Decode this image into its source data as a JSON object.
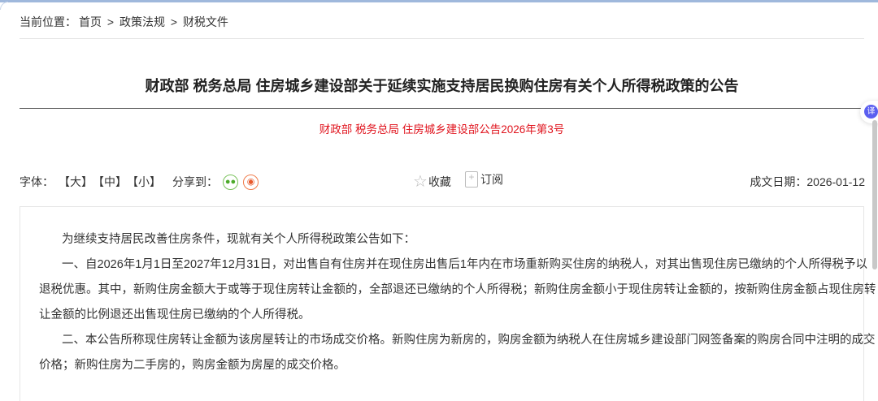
{
  "breadcrumb": {
    "label": "当前位置：",
    "items": [
      "首页",
      "政策法规",
      "财税文件"
    ],
    "sep": ">"
  },
  "title": "财政部 税务总局 住房城乡建设部关于延续实施支持居民换购住房有关个人所得税政策的公告",
  "doc_number": "财政部 税务总局 住房城乡建设部公告2026年第3号",
  "toolbar": {
    "font_label": "字体：",
    "font_large": "【大】",
    "font_medium": "【中】",
    "font_small": "【小】",
    "share_label": "分享到：",
    "favorite": "收藏",
    "subscribe": "订阅",
    "date_label": "成文日期：",
    "date": "2026-01-12"
  },
  "translate_label": "译",
  "body": {
    "paragraphs": [
      [
        "为继续支持居民改善住房条件，现就有关个人所得税政策公告如下："
      ],
      [
        "一、自2026年1月1日至2027年12月31日，对出售自有住房并在现住房出售后1年内在市场重新购买住房的纳税人，对其出售现住房已缴纳的个人所得税予以",
        "退税优惠。其中，新购住房金额大于或等于现住房转让金额的，全部退还已缴纳的个人所得税；新购住房金额小于现住房转让金额的，按新购住房金额占现住房转",
        "让金额的比例退还出售现住房已缴纳的个人所得税。"
      ],
      [
        "二、本公告所称现住房转让金额为该房屋转让的市场成交价格。新购住房为新房的，购房金额为纳税人在住房城乡建设部门网签备案的购房合同中注明的成交",
        "价格；新购住房为二手房的，购房金额为房屋的成交价格。"
      ]
    ]
  },
  "colors": {
    "doc_number": "#e0141e",
    "accent": "#5b5ff0"
  }
}
